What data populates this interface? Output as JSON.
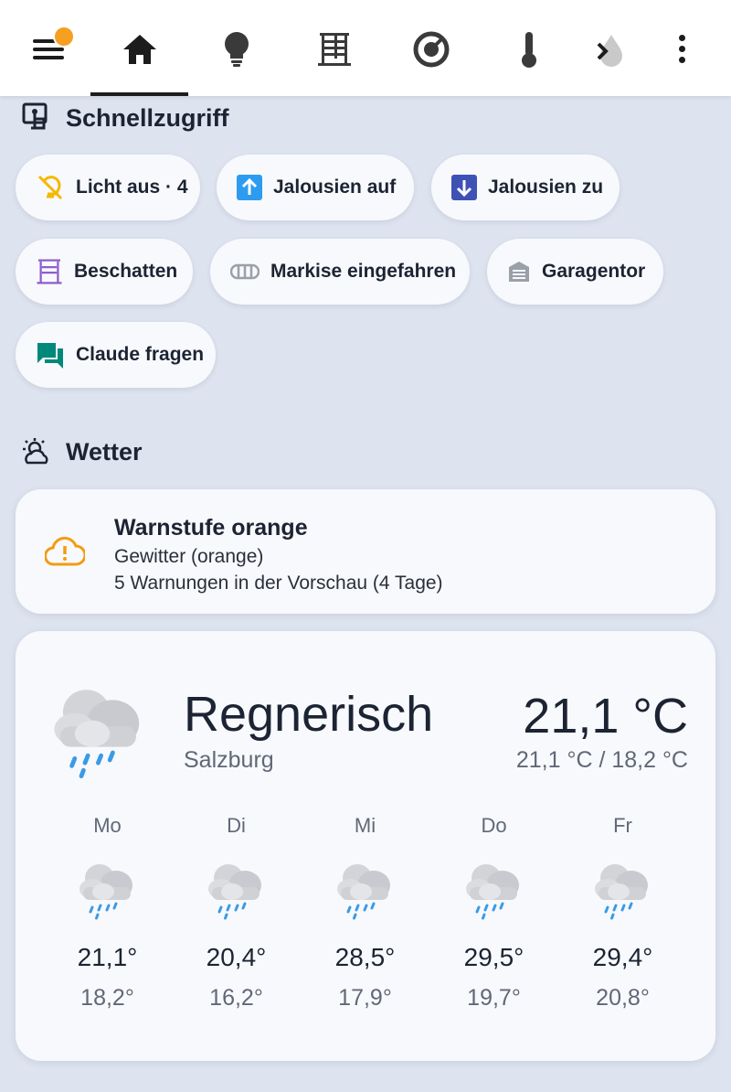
{
  "nav": {
    "tabs": [
      {
        "icon": "home-icon",
        "active": true
      },
      {
        "icon": "lightbulb-icon",
        "active": false
      },
      {
        "icon": "window-shutter-icon",
        "active": false
      },
      {
        "icon": "gauge-icon",
        "active": false
      },
      {
        "icon": "thermometer-icon",
        "active": false
      },
      {
        "icon": "water-icon",
        "active": false
      }
    ],
    "notification_color": "#f5a020"
  },
  "quick_access": {
    "title": "Schnellzugriff",
    "chips": [
      {
        "label": "Licht aus · 4",
        "icon": "lightbulb-off-icon",
        "color": "#f5b800"
      },
      {
        "label": "Jalousien auf",
        "icon": "arrow-up-box-icon",
        "color": "#2d9bf0"
      },
      {
        "label": "Jalousien zu",
        "icon": "arrow-down-box-icon",
        "color": "#3f51b5"
      },
      {
        "label": "Beschatten",
        "icon": "window-shutter-icon",
        "color": "#8e5ccf"
      },
      {
        "label": "Markise eingefahren",
        "icon": "awning-icon",
        "color": "#9aa0a8"
      },
      {
        "label": "Garagentor",
        "icon": "garage-icon",
        "color": "#9aa0a8"
      },
      {
        "label": "Claude fragen",
        "icon": "chat-icon",
        "color": "#00897b"
      }
    ]
  },
  "weather": {
    "title": "Wetter",
    "warning": {
      "title": "Warnstufe orange",
      "line1": "Gewitter (orange)",
      "line2": "5 Warnungen in der Vorschau (4 Tage)",
      "color": "#f39c12"
    },
    "current": {
      "condition": "Regnerisch",
      "location": "Salzburg",
      "temperature": "21,1 °C",
      "range": "21,1 °C / 18,2 °C",
      "icon": "rainy-cloud-icon"
    },
    "forecast": [
      {
        "day": "Mo",
        "high": "21,1°",
        "low": "18,2°"
      },
      {
        "day": "Di",
        "high": "20,4°",
        "low": "16,2°"
      },
      {
        "day": "Mi",
        "high": "28,5°",
        "low": "17,9°"
      },
      {
        "day": "Do",
        "high": "29,5°",
        "low": "19,7°"
      },
      {
        "day": "Fr",
        "high": "29,4°",
        "low": "20,8°"
      }
    ]
  }
}
